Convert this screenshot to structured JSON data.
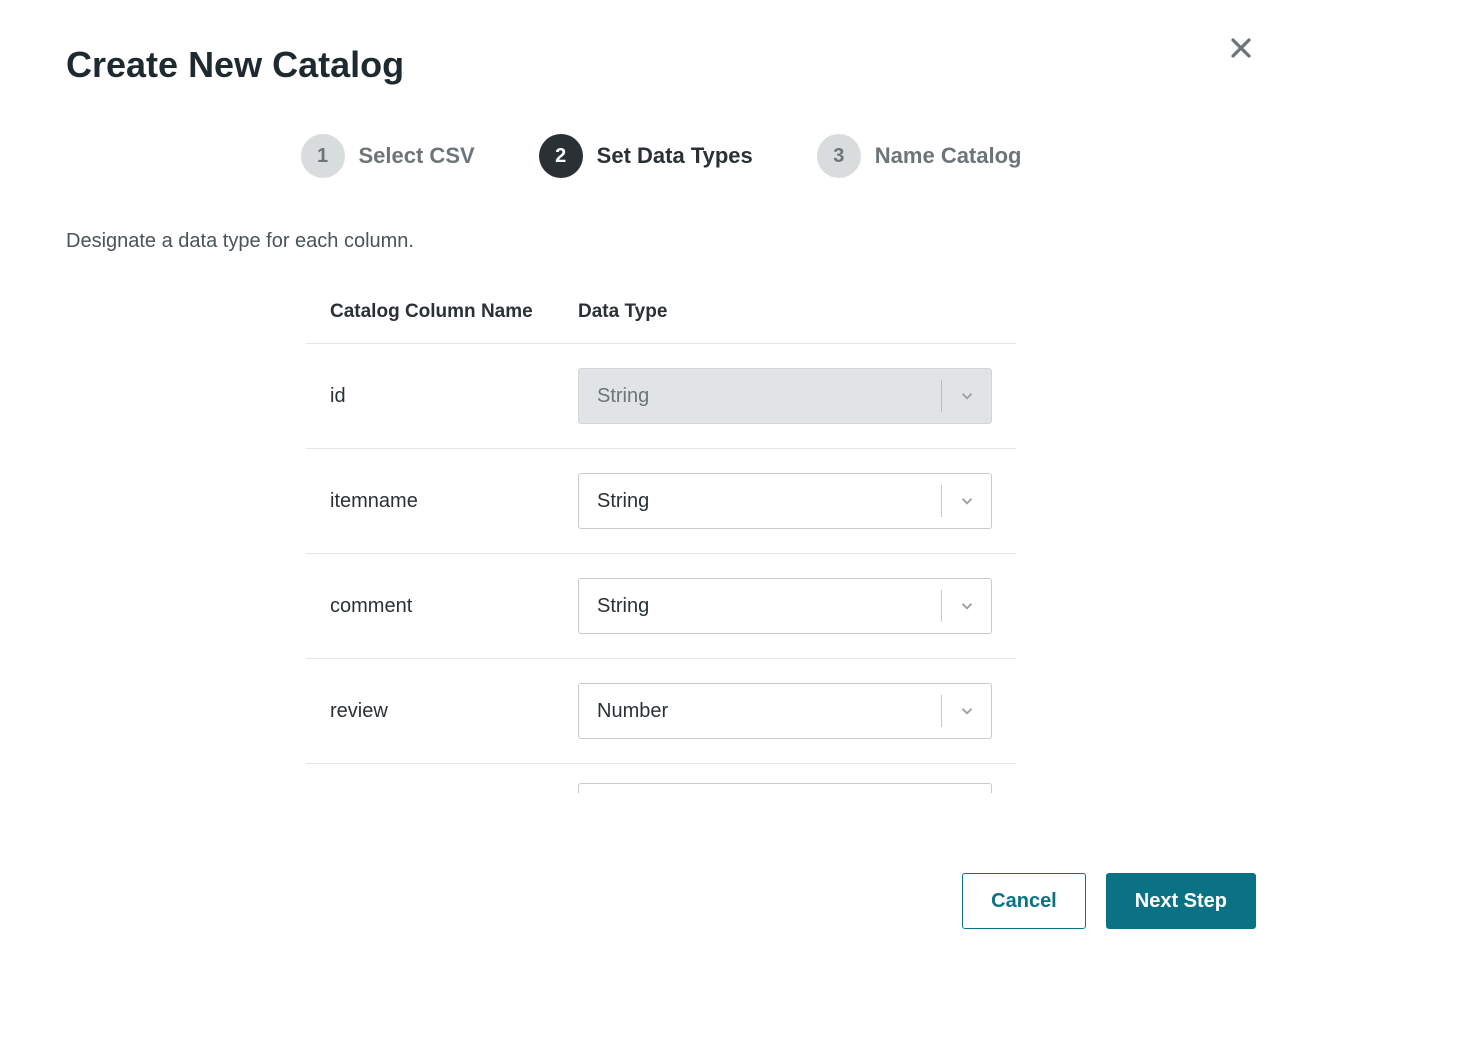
{
  "title": "Create New Catalog",
  "steps": [
    {
      "num": "1",
      "label": "Select CSV",
      "active": false
    },
    {
      "num": "2",
      "label": "Set Data Types",
      "active": true
    },
    {
      "num": "3",
      "label": "Name Catalog",
      "active": false
    }
  ],
  "instruction": "Designate a data type for each column.",
  "table": {
    "headers": {
      "name": "Catalog Column Name",
      "type": "Data Type"
    },
    "rows": [
      {
        "name": "id",
        "type": "String",
        "disabled": true
      },
      {
        "name": "itemname",
        "type": "String",
        "disabled": false
      },
      {
        "name": "comment",
        "type": "String",
        "disabled": false
      },
      {
        "name": "review",
        "type": "Number",
        "disabled": false
      }
    ]
  },
  "buttons": {
    "cancel": "Cancel",
    "next": "Next Step"
  }
}
